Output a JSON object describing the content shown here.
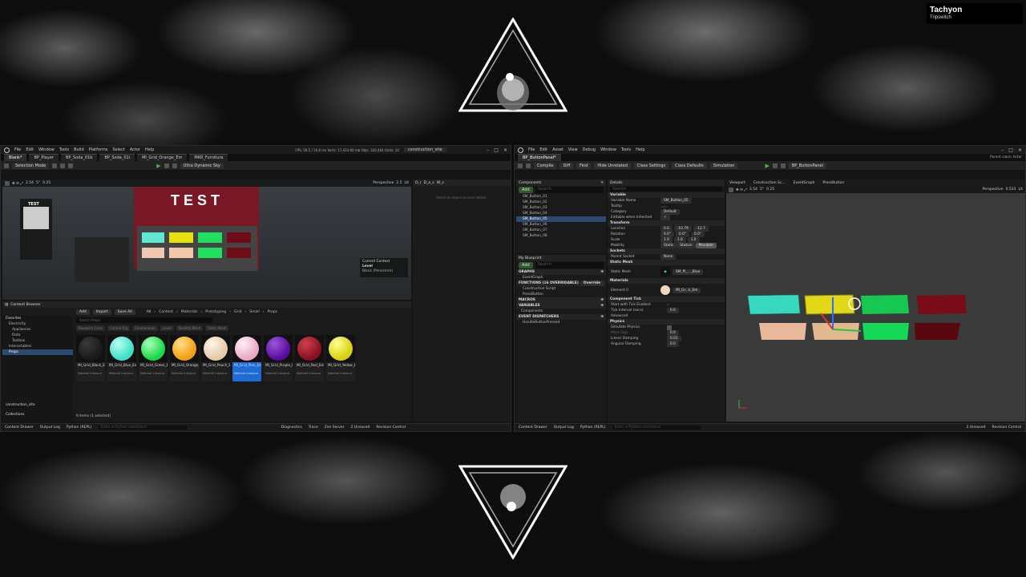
{
  "brand": {
    "name": "Tachyon",
    "subtitle": "Tripswitch"
  },
  "colors": {
    "accent": "#1e6bd6",
    "play": "#4caf50",
    "selection": "#2e4a73"
  },
  "left_window": {
    "menu": [
      "File",
      "Edit",
      "Window",
      "Tools",
      "Build",
      "Platforms",
      "Select",
      "Actor",
      "Help"
    ],
    "stats": "FPS: 59.5  /  16.8 ms   Verts: 17,414.66 mb   Objs: 320,464   Units: 10",
    "project": "construction_site",
    "tabs": [
      "Blank*",
      "BP_Player",
      "BP_Soda_01b",
      "BP_Soda_01i",
      "MI_Grid_Orange_Em",
      "MKR_Furniture"
    ],
    "toolbar": {
      "mode": "Selection Mode",
      "platform": "Ultra Dynamic Sky"
    },
    "viewport": {
      "perspective": "Perspective",
      "lit": "Lit",
      "scale": "2.54",
      "angle": "5°",
      "speed": "0.25",
      "fov": "2.5",
      "test_sign": "TEST",
      "small_sign": "TEST",
      "current_context": "Current Context",
      "level_label": "Level",
      "level_value": "Blank (Persistent)"
    },
    "outliner": {
      "col1": "O_r",
      "col2": "D_e_s",
      "col3": "W_s",
      "hint": "Select an object to view details."
    },
    "content_browser": {
      "title": "Content Browser",
      "add": "Add",
      "import": "Import",
      "save_all": "Save All",
      "path": [
        "All",
        "Content",
        "Materials",
        "Prototyping",
        "Grid",
        "Small",
        "Props"
      ],
      "search_placeholder": "Search Props",
      "favorites": "Favorites",
      "tree": [
        "Electricity",
        "Appliances",
        "Data",
        "Toolbox",
        "Interactables",
        "Props"
      ],
      "filters": [
        "Blueprint Class",
        "Control Rig",
        "Enumeration",
        "Level",
        "Skeletal Mesh",
        "Static Mesh"
      ],
      "assets": [
        {
          "name": "MI_Grid_Black_Em",
          "type": "Material Instance",
          "color": "#1a1a1a",
          "hl": "#3a3a3a"
        },
        {
          "name": "MI_Grid_Blue_Em",
          "type": "Material Instance",
          "color": "#3fe0c8",
          "hl": "#b8fff0"
        },
        {
          "name": "MI_Grid_Green_Em",
          "type": "Material Instance",
          "color": "#19d948",
          "hl": "#aaffb8"
        },
        {
          "name": "MI_Grid_Orange_Em",
          "type": "Material Instance",
          "color": "#f0a010",
          "hl": "#ffe08a"
        },
        {
          "name": "MI_Grid_Peach_Em",
          "type": "Material Instance",
          "color": "#e4c9a8",
          "hl": "#fff4e6"
        },
        {
          "name": "MI_Grid_Pink_Em",
          "type": "Material Instance",
          "color": "#e9a9c6",
          "hl": "#fff0f6"
        },
        {
          "name": "MI_Grid_Purple_Em",
          "type": "Material Instance",
          "color": "#5a0ca0",
          "hl": "#9b56d8"
        },
        {
          "name": "MI_Grid_Red_Em",
          "type": "Material Instance",
          "color": "#8a1020",
          "hl": "#d04050"
        },
        {
          "name": "MI_Grid_Yellow_Em",
          "type": "Material Instance",
          "color": "#d8d010",
          "hl": "#ffff90"
        }
      ],
      "selected_index": 5,
      "count": "9 items (1 selected)",
      "sections": [
        "construction_site",
        "Collections"
      ]
    },
    "status": {
      "drawer": "Content Drawer",
      "log": "Output Log",
      "cmd": "Python (REPL)",
      "cmd_placeholder": "Enter a Python command",
      "diag": "Diagnostics",
      "trace": "Trace",
      "zen": "Zen Server",
      "unsaved": "2 Unsaved",
      "rev": "Revision Control"
    }
  },
  "right_window": {
    "menu": [
      "File",
      "Edit",
      "Asset",
      "View",
      "Debug",
      "Window",
      "Tools",
      "Help"
    ],
    "tab": "BP_ButtonPanel*",
    "parent": "Parent class: Actor",
    "toolbar": [
      "Compile",
      "Diff",
      "Find",
      "Hide Unrelated",
      "Class Settings",
      "Class Defaults",
      "Simulation"
    ],
    "debug_target": "BP_ButtonPanel",
    "components": {
      "title": "Components",
      "add": "Add",
      "search": "Search",
      "items": [
        "SM_Button_01",
        "SM_Button_02",
        "SM_Button_03",
        "SM_Button_04",
        "SM_Button_05",
        "SM_Button_06",
        "SM_Button_07",
        "SM_Button_08"
      ],
      "selected": 4
    },
    "my_blueprint": {
      "title": "My Blueprint",
      "add": "Add",
      "search": "Search",
      "graphs": "GRAPHS",
      "event_graph": "EventGraph",
      "functions": "FUNCTIONS (16 OVERRIDABLE)",
      "override": "Override",
      "fn_items": [
        "Construction Script",
        "PressButton"
      ],
      "macros": "MACROS",
      "variables": "VARIABLES",
      "comps": "Components",
      "dispatchers": "EVENT DISPATCHERS",
      "dispatch_item": "HandleButtonPressed"
    },
    "details": {
      "title": "Details",
      "search": "Search",
      "variable": "Variable",
      "rows": [
        {
          "label": "Variable Name",
          "value": "SM_Button_05"
        },
        {
          "label": "Tooltip",
          "value": ""
        },
        {
          "label": "Category",
          "value": "Default"
        },
        {
          "label": "Editable when Inherited",
          "value": "✓"
        }
      ],
      "transform": "Transform",
      "location": {
        "label": "Location",
        "v": [
          "0.0",
          "-10.79",
          "-12.7"
        ]
      },
      "rotation": {
        "label": "Rotation",
        "v": [
          "0.0°",
          "0.0°",
          "0.0°"
        ]
      },
      "scale": {
        "label": "Scale",
        "v": [
          "1.0",
          "1.0",
          "1.0"
        ]
      },
      "mobility": {
        "label": "Mobility",
        "opts": [
          "Static",
          "Station",
          "Movable"
        ]
      },
      "sockets": "Sockets",
      "parent_socket": "Parent Socket",
      "socket_val": "None",
      "static_mesh": "Static Mesh",
      "sm_label": "Static Mesh",
      "sm_val": "SM_Pl_..._Blue",
      "materials": "Materials",
      "element": "Element 0",
      "mat_val": "MI_Gr...k_Em",
      "component_tick": "Component Tick",
      "start_tick": "Start with Tick Enabled",
      "tick_interval": "Tick Interval (secs)",
      "tick_val": "0.0",
      "advanced": "Advanced",
      "physics": "Physics",
      "sim_physics": "Simulate Physics",
      "mass": "Mass (kg)",
      "mass_val": "0.0",
      "linear": "Linear Damping",
      "linear_val": "0.01",
      "angular": "Angular Damping",
      "angular_val": "0.0"
    },
    "viewport_tabs": [
      "Viewport",
      "Construction Sc...",
      "EventGraph",
      "PressButton"
    ],
    "viewport": {
      "perspective": "Perspective",
      "lit": "Lit",
      "scale": "2.54",
      "angle": "5°",
      "speed": "0.25",
      "fov": "0.533"
    },
    "status": {
      "drawer": "Content Drawer",
      "log": "Output Log",
      "cmd": "Python (REPL)",
      "cmd_placeholder": "Enter a Python command",
      "unsaved": "2 Unsaved",
      "rev": "Revision Control"
    }
  }
}
